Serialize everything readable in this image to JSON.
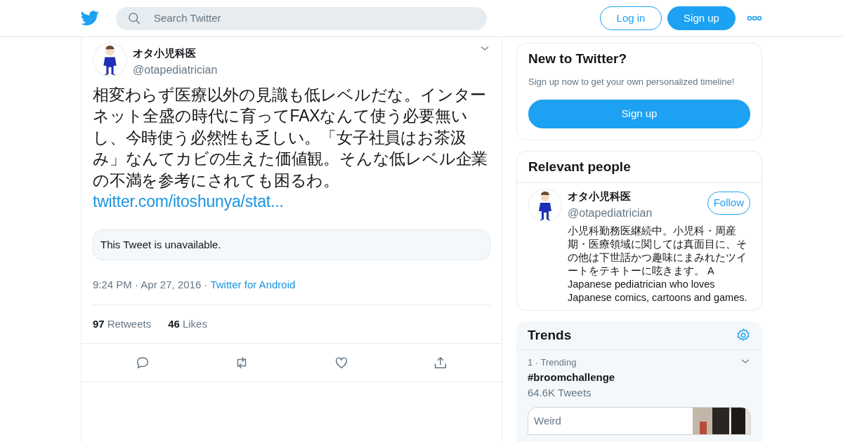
{
  "header": {
    "search": {
      "placeholder": "Search Twitter"
    },
    "buttons": [
      {
        "kind": "outline",
        "label": "Log in"
      },
      {
        "kind": "solid",
        "label": "Sign up"
      }
    ]
  },
  "tweet": {
    "author": {
      "name": "オタ小児科医",
      "handle": "@otapediatrician"
    },
    "text": "相変わらず医療以外の見識も低レベルだな。インターネット全盛の時代に育ってFAXなんて使う必要無いし、今時使う必然性も乏しい。「女子社員はお茶汲み」なんてカビの生えた価値観。そんな低レベル企業の不満を参考にされても困るわ。",
    "link": "twitter.com/itoshunya/stat...",
    "quoted": "This Tweet is unavailable.",
    "time": "9:24 PM · Apr 27, 2016 ·",
    "source": "Twitter for Android",
    "stats": [
      {
        "count": "97",
        "label": "Retweets"
      },
      {
        "count": "46",
        "label": "Likes"
      }
    ]
  },
  "sidebar": {
    "signup_card": {
      "title": "New to Twitter?",
      "subtitle": "Sign up now to get your own personalized timeline!",
      "button": "Sign up"
    },
    "relevant_people": {
      "title": "Relevant people",
      "person": {
        "name": "オタ小児科医",
        "handle": "@otapediatrician",
        "button": "Follow",
        "bio": "小児科勤務医継続中。小児科・周産期・医療領域に関しては真面目に、その他は下世話かつ趣味にまみれたツイートをテキトーに呟きます。 A Japanese pediatrician who loves Japanese comics, cartoons and games."
      }
    },
    "trends": {
      "title": "Trends",
      "items": [
        {
          "meta": "1 · Trending",
          "tag": "#broomchallenge",
          "count": "64.6K Tweets",
          "card": {
            "text": "Weird",
            "kind": "picture"
          }
        }
      ]
    }
  }
}
